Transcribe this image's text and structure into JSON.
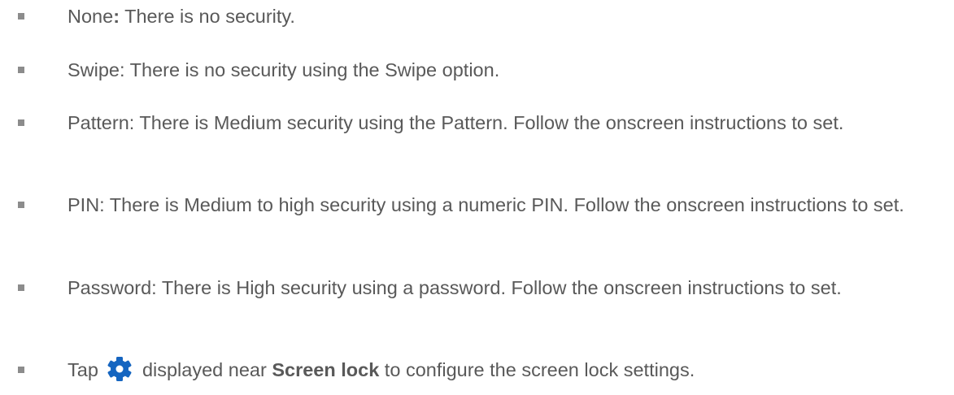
{
  "items": [
    {
      "label": "None",
      "colon": ":",
      "text": " There is no security."
    },
    {
      "text": "Swipe: There is no security using the Swipe option."
    },
    {
      "text": "Pattern: There is Medium security using the Pattern. Follow the onscreen instructions to set."
    },
    {
      "text": "PIN: There is Medium to high security using a numeric PIN. Follow the onscreen instructions to set."
    },
    {
      "text": "Password: There is High security using a password. Follow the onscreen instructions to set."
    },
    {
      "before": "Tap ",
      "icon": "gear-icon",
      "middle": " displayed near ",
      "bold": "Screen lock",
      "after": " to configure the screen lock settings."
    }
  ],
  "colors": {
    "text": "#595959",
    "bullet": "#8c8c8c",
    "icon": "#1565c0"
  }
}
